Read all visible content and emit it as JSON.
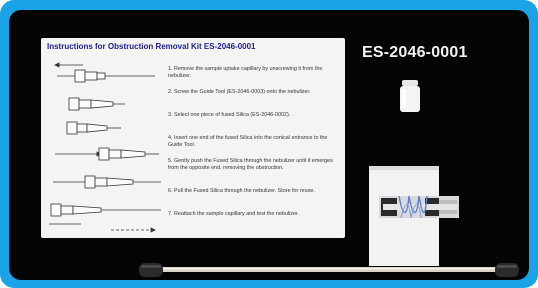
{
  "product": {
    "code": "ES-2046-0001"
  },
  "instructions": {
    "title": "Instructions for Obstruction Removal Kit ES-2046-0001",
    "steps": [
      {
        "n": "1.",
        "text": "Remove the sample uptake capillary by unscrewing it from the nebulizer."
      },
      {
        "n": "2.",
        "text": "Screw the Guide Tool (ES-2046-0003) onto the nebulizer."
      },
      {
        "n": "3.",
        "text": "Select one piece of fused Silica (ES-2046-0002)."
      },
      {
        "n": "4.",
        "text": "Insert one end of the fused Silica into the conical entrance to the Guide Tool."
      },
      {
        "n": "5.",
        "text": "Gently push the Fused Silica through the nebulizer until it emerges from the opposite end, removing the obstruction."
      },
      {
        "n": "6.",
        "text": "Pull the Fused Silica through the nebulizer. Store for reuse."
      },
      {
        "n": "7.",
        "text": "Reattach the sample capillary and test the nebulizer."
      }
    ]
  },
  "colors": {
    "border": "#1aa3e6",
    "background": "#050505",
    "title": "#1e1e8c"
  }
}
